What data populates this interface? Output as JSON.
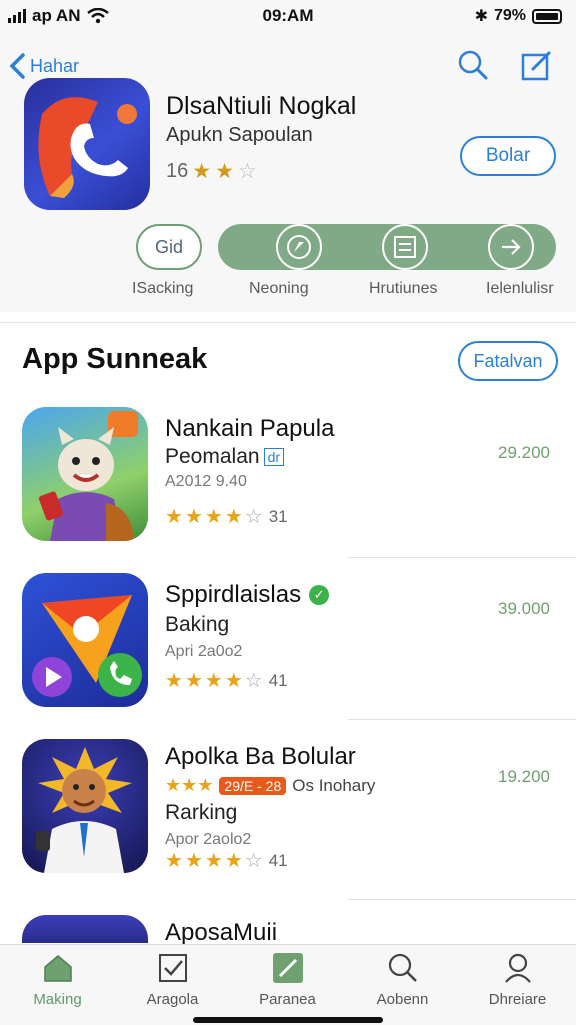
{
  "status": {
    "carrier": "ap AN",
    "time": "09:AM",
    "battery": "79%"
  },
  "header": {
    "back_label": "Hahar",
    "app_title": "DlsaNtiuli Nogkal",
    "app_subtitle": "Apukn Sapoulan",
    "rating_value": "16",
    "rating_stars": 2,
    "get_label": "Bolar"
  },
  "quick_actions": {
    "outline_pill": "Gid",
    "labels": [
      "ISacking",
      "Neoning",
      "Hrutiunes",
      "Ielenlulisr"
    ]
  },
  "section": {
    "title": "App Sunneak",
    "button_label": "Fatalvan",
    "apps": [
      {
        "name": "Nankain Papula",
        "subtitle": "Peomalan",
        "subtitle_badge": "dr",
        "date": "A2012 9.40",
        "stars": 4,
        "rating_count": "31",
        "price": "29.200"
      },
      {
        "name": "Sppirdlaislas",
        "verified": true,
        "subtitle": "Baking",
        "date": "Apri 2a0o2",
        "stars": 4,
        "rating_count": "41",
        "price": "39.000"
      },
      {
        "name": "Apolka Ba Bolular",
        "tag": "29/E - 28",
        "extra": "Os Inohary",
        "subtitle": "Rarking",
        "date": "Apor 2aolo2",
        "stars": 4,
        "rating_count": "41",
        "price": "19.200"
      },
      {
        "name": "AposaMuii",
        "subtitle": "",
        "date": "",
        "price": ""
      }
    ]
  },
  "tabbar": {
    "tabs": [
      {
        "label": "Making",
        "icon": "home-icon",
        "active": true
      },
      {
        "label": "Aragola",
        "icon": "checkbox-icon",
        "active": false
      },
      {
        "label": "Paranea",
        "icon": "chart-icon",
        "active": false
      },
      {
        "label": "Aobenn",
        "icon": "search-icon",
        "active": false
      },
      {
        "label": "Dhreiare",
        "icon": "profile-icon",
        "active": false
      }
    ]
  },
  "colors": {
    "accent": "#2b7fd8",
    "green": "#80a985",
    "star": "#e8a317",
    "price": "#6fa06f"
  }
}
